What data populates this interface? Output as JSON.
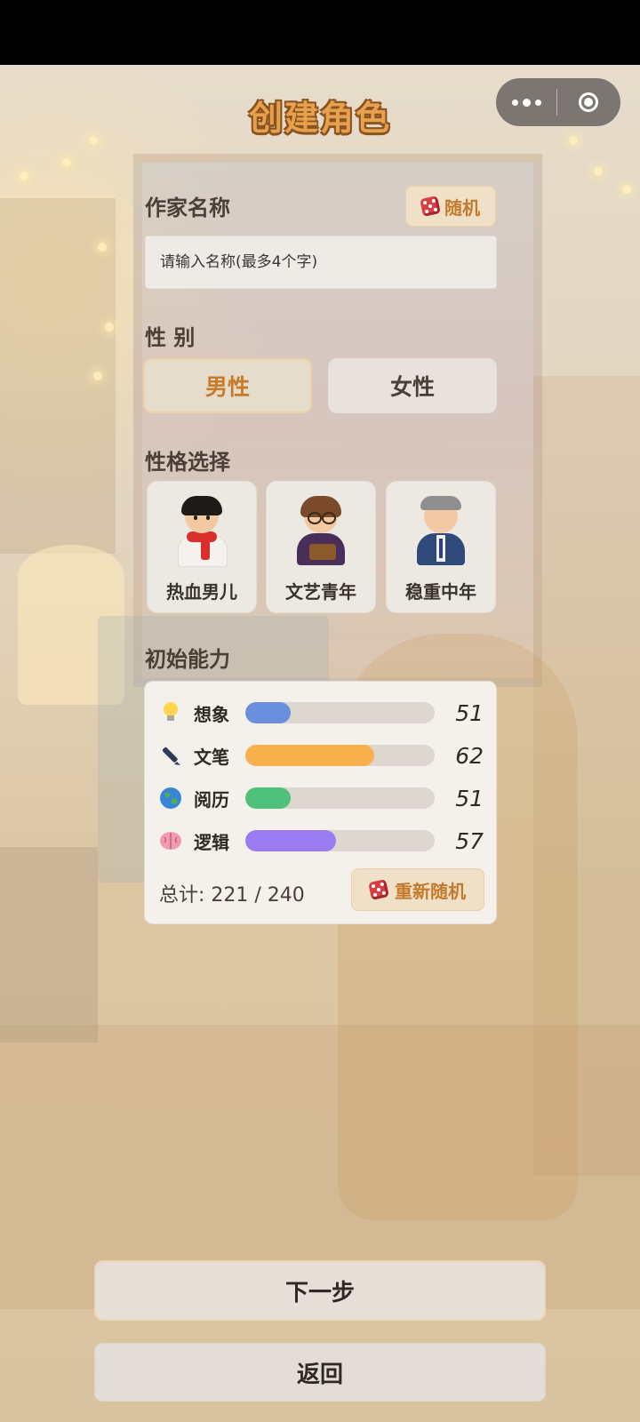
{
  "header": {
    "title": "创建角色"
  },
  "name_section": {
    "label": "作家名称",
    "random_label": "随机",
    "input_value": "",
    "input_placeholder": "请输入名称(最多4个字)"
  },
  "gender_section": {
    "label": "性 别",
    "options": [
      {
        "label": "男性",
        "selected": true
      },
      {
        "label": "女性",
        "selected": false
      }
    ]
  },
  "personality_section": {
    "label": "性格选择",
    "options": [
      {
        "label": "热血男儿",
        "icon": "hot-blooded-boy-avatar-icon"
      },
      {
        "label": "文艺青年",
        "icon": "artsy-youth-avatar-icon"
      },
      {
        "label": "稳重中年",
        "icon": "steady-middle-aged-avatar-icon"
      }
    ]
  },
  "ability_section": {
    "label": "初始能力",
    "stats": [
      {
        "name": "想象",
        "value": 51,
        "fill_percent": 24,
        "color": "#6a8fdc",
        "icon": "lightbulb-icon"
      },
      {
        "name": "文笔",
        "value": 62,
        "fill_percent": 68,
        "color": "#f8b14d",
        "icon": "pen-icon"
      },
      {
        "name": "阅历",
        "value": 51,
        "fill_percent": 24,
        "color": "#4fc17a",
        "icon": "globe-icon"
      },
      {
        "name": "逻辑",
        "value": 57,
        "fill_percent": 48,
        "color": "#9a7bf0",
        "icon": "brain-icon"
      }
    ],
    "total_text": "总计: 221 / 240",
    "reroll_label": "重新随机"
  },
  "footer": {
    "next_label": "下一步",
    "back_label": "返回"
  },
  "colors": {
    "accent": "#c47a2c",
    "title": "#e7a04e"
  }
}
